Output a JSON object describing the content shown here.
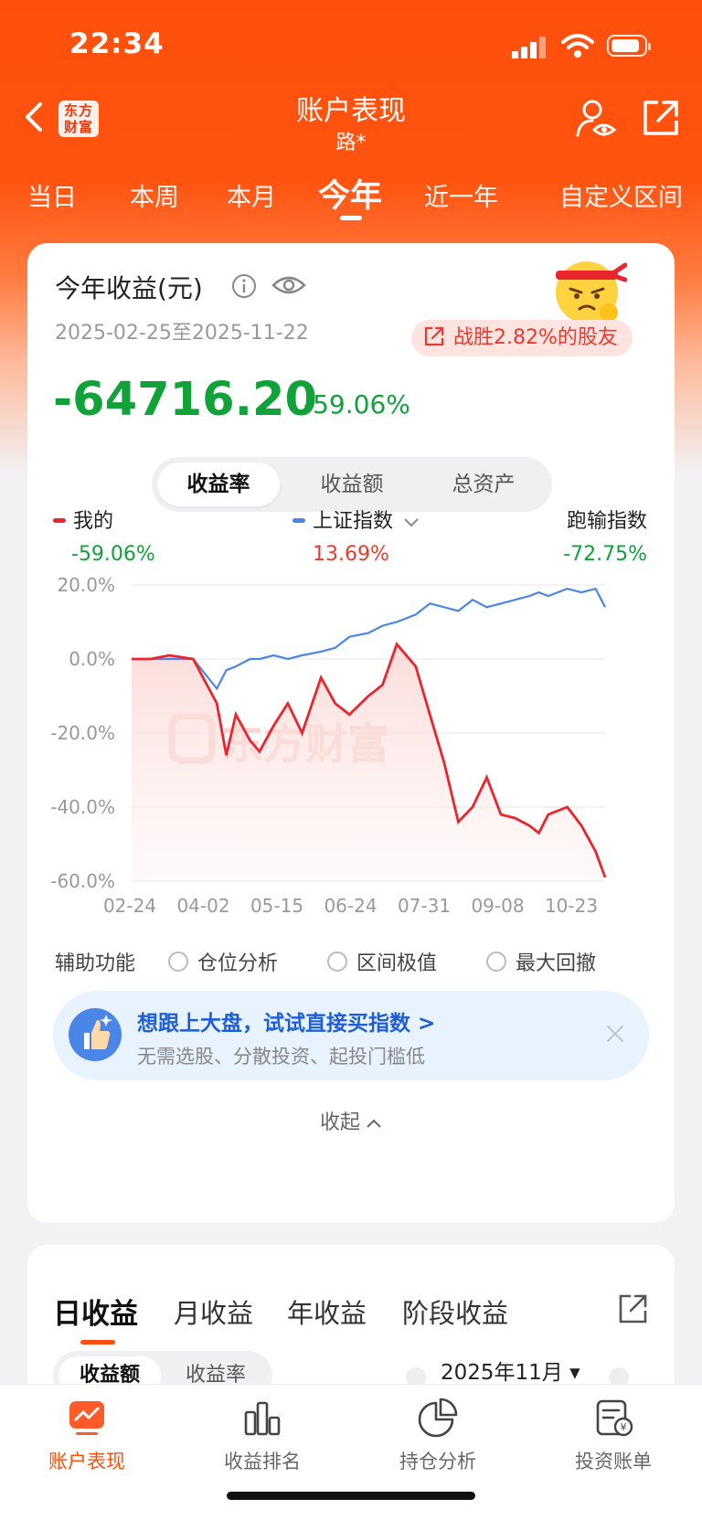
{
  "status": {
    "time": "22:34"
  },
  "nav": {
    "back_label": "返回",
    "logo_line1": "东方",
    "logo_line2": "财富",
    "title": "账户表现",
    "subtitle": "路*"
  },
  "tabs": [
    {
      "label": "当日",
      "active": false
    },
    {
      "label": "本周",
      "active": false
    },
    {
      "label": "本月",
      "active": false
    },
    {
      "label": "今年",
      "active": true
    },
    {
      "label": "近一年",
      "active": false
    },
    {
      "label": "自定义区间",
      "active": false
    }
  ],
  "summary": {
    "title": "今年收益(元)",
    "date_range": "2025-02-25至2025-11-22",
    "badge": "战胜2.82%的股友",
    "amount": "-64716.20",
    "percent": "-59.06%"
  },
  "segment": {
    "items": [
      "收益率",
      "收益额",
      "总资产"
    ],
    "active_index": 0
  },
  "legend": {
    "mine": {
      "name": "我的",
      "value": "-59.06%"
    },
    "index": {
      "name": "上证指数",
      "value": "13.69%"
    },
    "outperform": {
      "name": "跑输指数",
      "value": "-72.75%"
    }
  },
  "colors": {
    "brand": "#ff4f0d",
    "up": "#e63b2e",
    "down": "#11a23a",
    "mine_line": "#e8262b",
    "index_line": "#4a86e8",
    "accent_blue": "#1f5fd6"
  },
  "chart_data": {
    "type": "line",
    "ylim": [
      -60,
      20
    ],
    "yticks": [
      "20.0%",
      "0.0%",
      "-20.0%",
      "-40.0%",
      "-60.0%"
    ],
    "ytick_values": [
      20,
      0,
      -20,
      -40,
      -60
    ],
    "xticks": [
      "02-24",
      "04-02",
      "05-15",
      "06-24",
      "07-31",
      "09-08",
      "10-23"
    ],
    "watermark": "东方财富",
    "x": [
      0,
      4,
      8,
      13,
      18,
      20,
      22,
      25,
      27,
      30,
      33,
      36,
      40,
      43,
      46,
      50,
      53,
      56,
      60,
      63,
      66,
      69,
      72,
      75,
      78,
      81,
      84,
      86,
      88,
      92,
      95,
      98,
      100
    ],
    "series": [
      {
        "name": "我的",
        "color": "#e8262b",
        "values": [
          0,
          0,
          1,
          0,
          -12,
          -26,
          -15,
          -22,
          -25,
          -18,
          -12,
          -20,
          -5,
          -12,
          -15,
          -10,
          -7,
          4,
          -2,
          -15,
          -28,
          -44,
          -40,
          -32,
          -42,
          -43,
          -45,
          -47,
          -42,
          -40,
          -45,
          -52,
          -59
        ]
      },
      {
        "name": "上证指数",
        "color": "#4a86e8",
        "values": [
          0,
          0,
          0,
          0,
          -8,
          -3,
          -2,
          0,
          0,
          1,
          0,
          1,
          2,
          3,
          6,
          7,
          9,
          10,
          12,
          15,
          14,
          13,
          16,
          14,
          15,
          16,
          17,
          18,
          17,
          19,
          18,
          19,
          14
        ]
      }
    ]
  },
  "aux": {
    "label": "辅助功能",
    "options": [
      "仓位分析",
      "区间极值",
      "最大回撤"
    ]
  },
  "promo": {
    "title": "想跟上大盘，试试直接买指数 >",
    "subtitle": "无需选股、分散投资、起投门槛低",
    "icon": "thumbs-up-icon"
  },
  "collapse": {
    "label": "收起"
  },
  "section2": {
    "tabs": [
      "日收益",
      "月收益",
      "年收益",
      "阶段收益"
    ],
    "active_index": 0,
    "seg": [
      "收益额",
      "收益率"
    ],
    "month": "2025年11月"
  },
  "tabbar": [
    {
      "label": "账户表现",
      "icon": "trend-icon",
      "active": true
    },
    {
      "label": "收益排名",
      "icon": "bar-chart-icon",
      "active": false
    },
    {
      "label": "持仓分析",
      "icon": "pie-chart-icon",
      "active": false
    },
    {
      "label": "投资账单",
      "icon": "bill-icon",
      "active": false
    }
  ]
}
